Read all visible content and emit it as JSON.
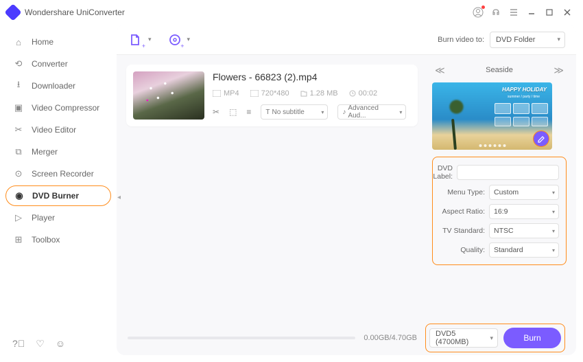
{
  "app_title": "Wondershare UniConverter",
  "sidebar": {
    "items": [
      {
        "label": "Home"
      },
      {
        "label": "Converter"
      },
      {
        "label": "Downloader"
      },
      {
        "label": "Video Compressor"
      },
      {
        "label": "Video Editor"
      },
      {
        "label": "Merger"
      },
      {
        "label": "Screen Recorder"
      },
      {
        "label": "DVD Burner"
      },
      {
        "label": "Player"
      },
      {
        "label": "Toolbox"
      }
    ]
  },
  "topbar": {
    "burn_to_label": "Burn video to:",
    "burn_to_value": "DVD Folder"
  },
  "file": {
    "title": "Flowers - 66823 (2).mp4",
    "format": "MP4",
    "resolution": "720*480",
    "size": "1.28 MB",
    "duration": "00:02",
    "subtitle": "No subtitle",
    "audio": "Advanced Aud..."
  },
  "template": {
    "name": "Seaside",
    "banner_text": "HAPPY HOLIDAY",
    "banner_sub": "summer / party / time"
  },
  "settings": {
    "dvd_label_label": "DVD Label:",
    "dvd_label_value": "",
    "menu_type_label": "Menu Type:",
    "menu_type_value": "Custom",
    "aspect_ratio_label": "Aspect Ratio:",
    "aspect_ratio_value": "16:9",
    "tv_standard_label": "TV Standard:",
    "tv_standard_value": "NTSC",
    "quality_label": "Quality:",
    "quality_value": "Standard"
  },
  "bottom": {
    "size_text": "0.00GB/4.70GB",
    "disc_type": "DVD5 (4700MB)",
    "burn_label": "Burn"
  }
}
